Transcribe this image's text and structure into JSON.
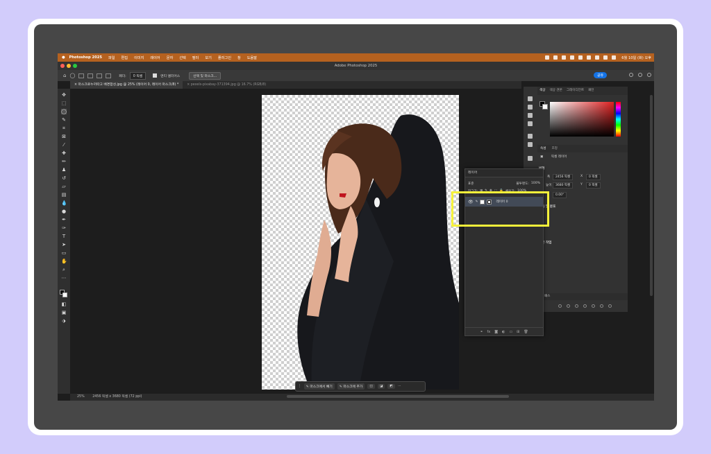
{
  "menubar": {
    "app_name": "Photoshop 2025",
    "items": [
      "파일",
      "편집",
      "이미지",
      "레이어",
      "문자",
      "선택",
      "필터",
      "보기",
      "플러그인",
      "창",
      "도움말"
    ],
    "datetime": "6월 10일 (화) 오후"
  },
  "window": {
    "title": "Adobe Photoshop 2025"
  },
  "options": {
    "feather_label": "페더:",
    "feather_value": "0 픽셀",
    "antialias_label": "앤티 앨리어스",
    "select_mask_button": "선택 및 마스크...",
    "share_button": "공유"
  },
  "tabs": [
    {
      "label": "마스크로누끼따고 배경합성.jpg @ 25% (레이어 0, 레이어 마스크/8) *"
    },
    {
      "label": "pexels-pixabay-371394.jpg @ 16.7% (RGB/8)"
    }
  ],
  "context_bar": {
    "subtract_label": "마스크에서 빼기",
    "add_label": "마스크에 추가"
  },
  "status": {
    "zoom": "25%",
    "doc_info": "2456 픽셀 x 3680 픽셀 (72 ppi)"
  },
  "color_panel": {
    "tabs": [
      "색상",
      "색상 견본",
      "그레이디언트",
      "패턴"
    ]
  },
  "properties_panel": {
    "tabs": [
      "속성",
      "조정"
    ],
    "layer_type": "픽셀 레이어",
    "transform_label": "변형",
    "width_label": "폭",
    "width": "2456 픽셀",
    "height_label": "높이",
    "height": "3680 픽셀",
    "x_label": "X",
    "x": "0 픽셀",
    "y_label": "Y",
    "y": "0 픽셀",
    "angle": "0.00°",
    "align_label": "맞춤 및 분포",
    "quick_actions_label": "빠른 작업",
    "lower_tab": "패스"
  },
  "layers_panel": {
    "title": "레이어",
    "blend_mode": "표준",
    "opacity_label": "불투명도:",
    "opacity": "100%",
    "lock_label": "잠그기:",
    "fill_label": "채우기:",
    "fill": "100%",
    "layer_name": "레이어 0"
  }
}
